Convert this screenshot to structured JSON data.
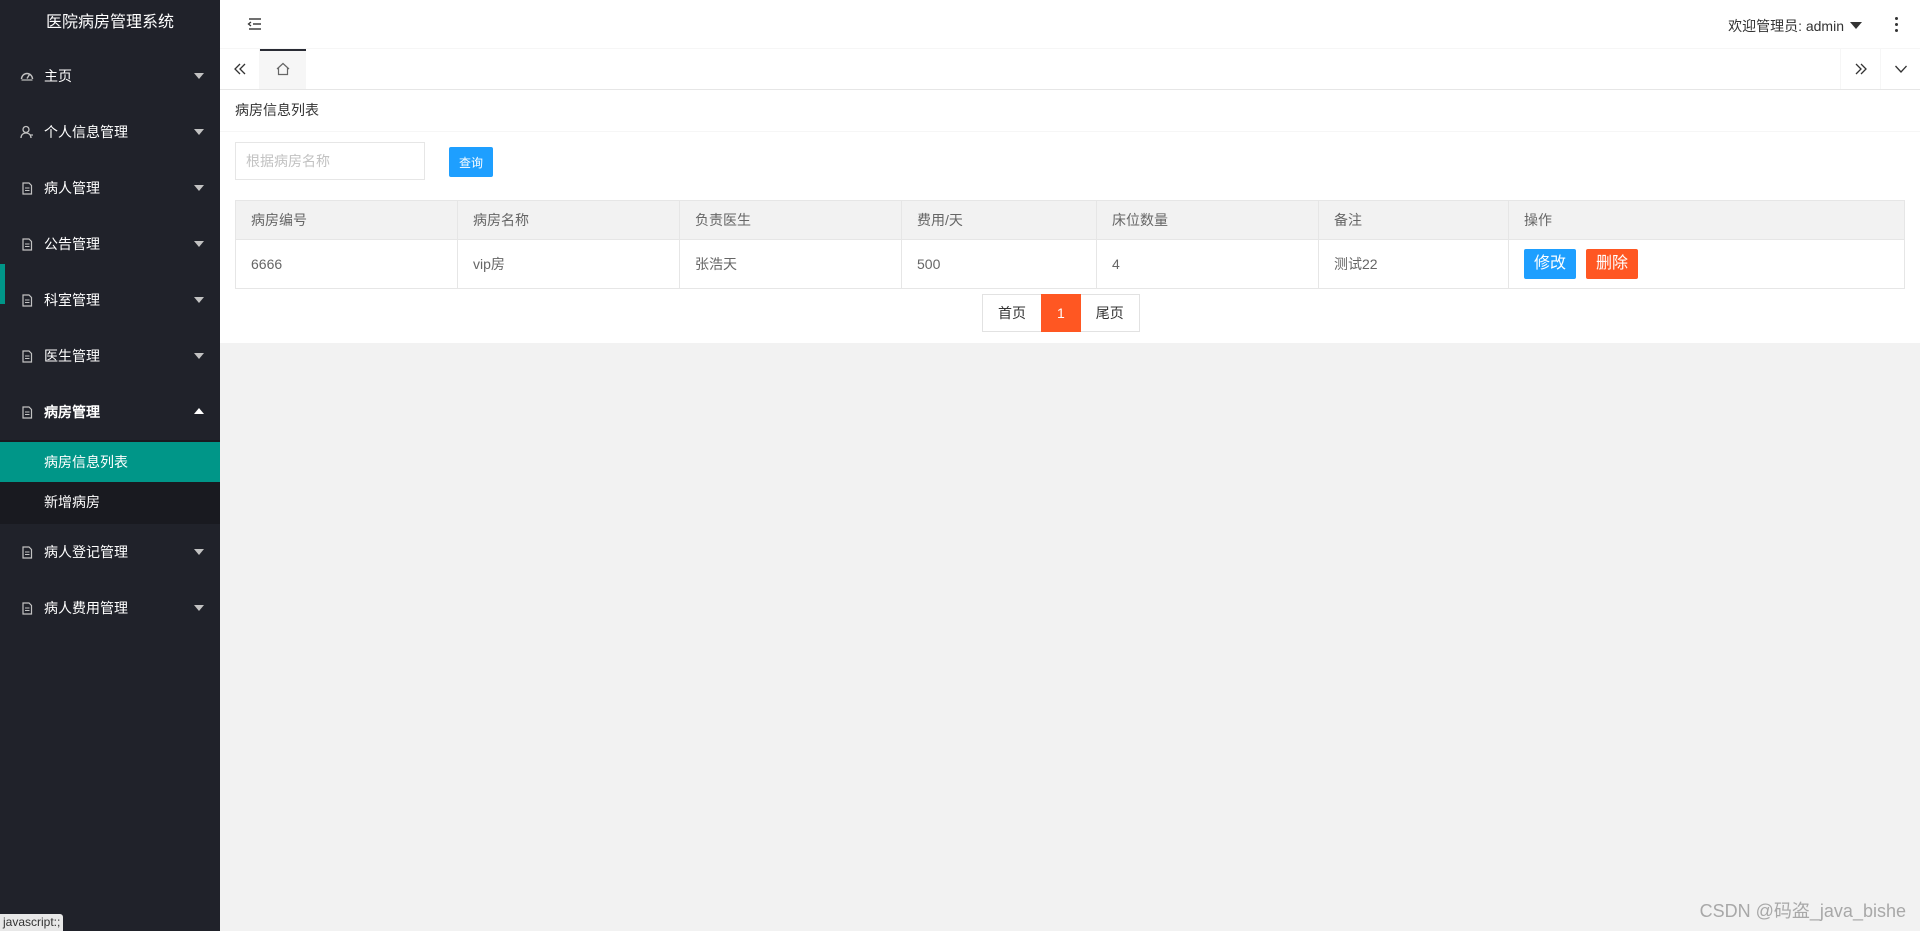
{
  "app": {
    "title": "医院病房管理系统"
  },
  "sidebar": {
    "items": [
      {
        "label": "主页",
        "icon": "dashboard-icon"
      },
      {
        "label": "个人信息管理",
        "icon": "user-icon"
      },
      {
        "label": "病人管理",
        "icon": "file-icon"
      },
      {
        "label": "公告管理",
        "icon": "file-icon"
      },
      {
        "label": "科室管理",
        "icon": "file-icon"
      },
      {
        "label": "医生管理",
        "icon": "file-icon"
      },
      {
        "label": "病房管理",
        "icon": "file-icon",
        "expanded": true,
        "children": [
          {
            "label": "病房信息列表",
            "active": true
          },
          {
            "label": "新增病房"
          }
        ]
      },
      {
        "label": "病人登记管理",
        "icon": "file-icon"
      },
      {
        "label": "病人费用管理",
        "icon": "file-icon"
      }
    ]
  },
  "header": {
    "welcome": "欢迎管理员: admin"
  },
  "content": {
    "title": "病房信息列表",
    "search": {
      "placeholder": "根据病房名称",
      "value": "",
      "button": "查询"
    },
    "table": {
      "columns": [
        "病房编号",
        "病房名称",
        "负责医生",
        "费用/天",
        "床位数量",
        "备注",
        "操作"
      ],
      "rows": [
        {
          "cells": [
            "6666",
            "vip房",
            "张浩天",
            "500",
            "4",
            "测试22"
          ],
          "edit": "修改",
          "delete": "删除"
        }
      ]
    },
    "pagination": {
      "first": "首页",
      "current": "1",
      "last": "尾页"
    }
  },
  "status_hint": "javascript:;",
  "watermark": "CSDN @码盗_java_bishe",
  "colors": {
    "sidebar": "#20222a",
    "accent": "#009688",
    "primary": "#1e9fff",
    "danger": "#ff5722"
  }
}
